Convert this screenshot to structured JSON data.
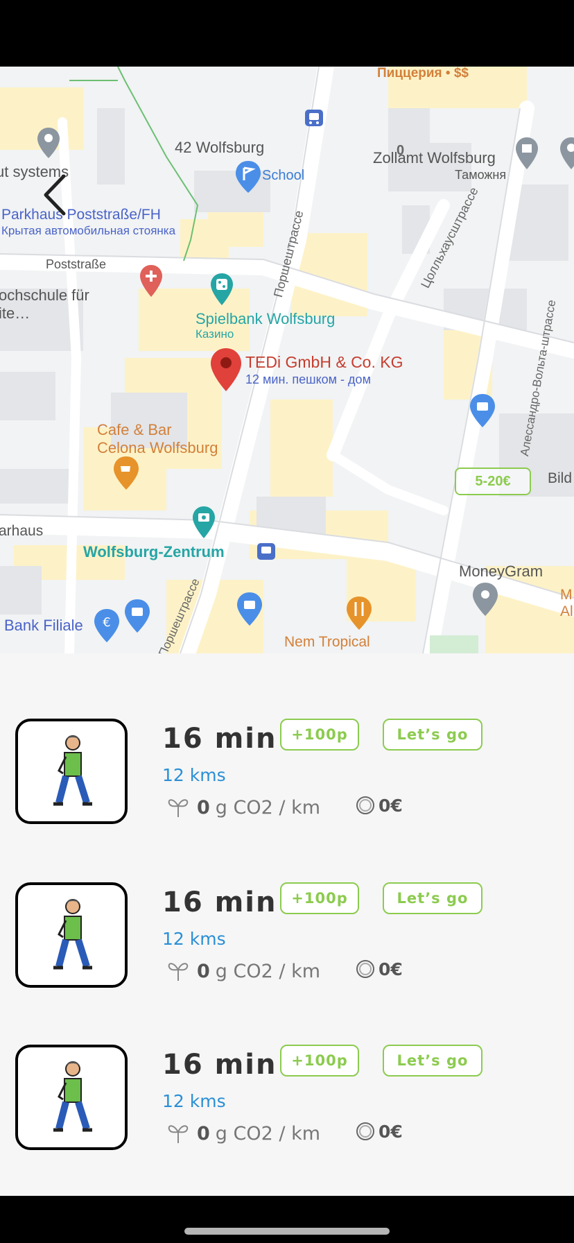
{
  "map": {
    "labels": {
      "pizzeria": "Пиццерия • $$",
      "wolfsburg42": "42 Wolfsburg",
      "school": "School",
      "zollamt": "Zollamt Wolfsburg",
      "zollamt_ru": "Таможня",
      "systems": "ut systems",
      "parkhaus": "Parkhaus Poststraße/FH",
      "parkhaus_ru": "Крытая автомобильная стоянка",
      "poststrasse": "Poststraße",
      "hochschule": "ochschule für",
      "hochschule2": "ite…",
      "porsche_street": "Поршештрассе",
      "porsche_street2": "Поршештрассе",
      "pollhaus_street": "Цолльхаусштрассе",
      "volta_street": "Алессандро-Вольта-штрассе",
      "spielbank": "Spielbank Wolfsburg",
      "spielbank_ru": "Казино",
      "tedi": "TEDi GmbH & Co. KG",
      "tedi_sub": "12 мин. пешком - дом",
      "cafe": "Cafe & Bar",
      "cafe2": "Celona Wolfsburg",
      "bild": "Bild",
      "arhaus": "arhaus",
      "zentrum": "Wolfsburg-Zentrum",
      "moneygram": "MoneyGram",
      "m_al": "M",
      "m_al2": "Al",
      "bank": "Bank Filiale",
      "nem": "Nem Tropical",
      "zero": "0"
    },
    "price_tag": "5-20€"
  },
  "routes": [
    {
      "duration": "16 min",
      "distance": "12 kms",
      "points_label": "+100p",
      "go_label": "Let’s go",
      "co2_value": "0",
      "co2_unit": "g CO2 / km",
      "cost": "0€"
    },
    {
      "duration": "16 min",
      "distance": "12 kms",
      "points_label": "+100p",
      "go_label": "Let’s go",
      "co2_value": "0",
      "co2_unit": "g CO2 / km",
      "cost": "0€"
    },
    {
      "duration": "16 min",
      "distance": "12 kms",
      "points_label": "+100p",
      "go_label": "Let’s go",
      "co2_value": "0",
      "co2_unit": "g CO2 / km",
      "cost": "0€"
    }
  ],
  "colors": {
    "accent_green": "#8ccb4f",
    "link_blue": "#2a8fd6",
    "pin_red": "#e0413a",
    "poi_blue": "#4a8ee8",
    "poi_orange": "#e6932b",
    "poi_teal": "#26a5a5"
  },
  "icons": {
    "back": "chevron-left-icon",
    "leaf": "leaf-icon",
    "coin": "coin-icon",
    "walker": "pedestrian-icon"
  }
}
